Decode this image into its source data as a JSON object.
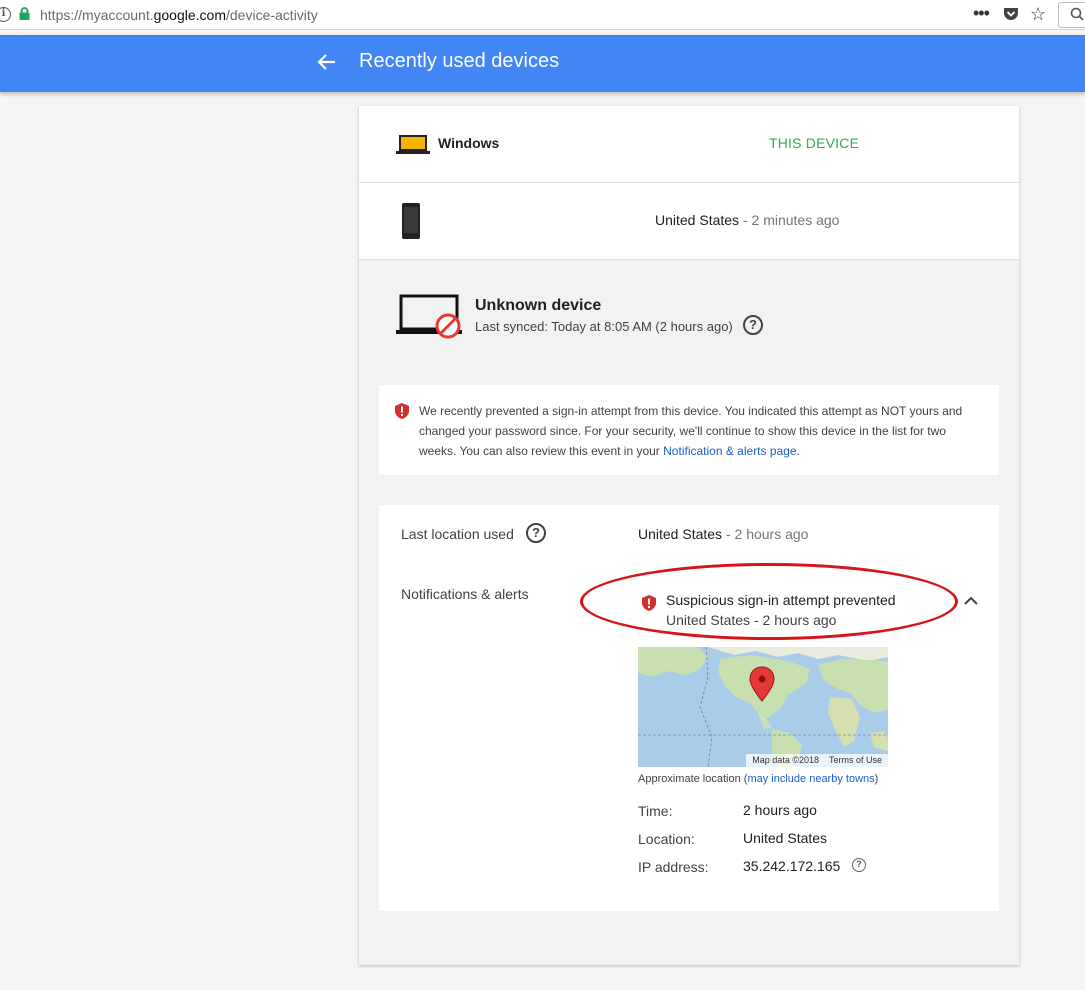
{
  "browser": {
    "url_prefix": "https://myaccount.",
    "url_domain": "google.com",
    "url_path": "/device-activity"
  },
  "header": {
    "title": "Recently used devices"
  },
  "devices": {
    "windows": {
      "name": "Windows",
      "status": "THIS DEVICE"
    },
    "phone": {
      "location": "United States",
      "separator": " - ",
      "time": "2 minutes ago"
    }
  },
  "unknown": {
    "title": "Unknown device",
    "subtitle": "Last synced: Today at 8:05 AM (2 hours ago)",
    "warning_text": "We recently prevented a sign-in attempt from this device. You indicated this attempt as NOT yours and changed your password since. For your security, we'll continue to show this device in the list for two weeks. You can also review this event in your ",
    "warning_link": "Notification & alerts page",
    "warning_end": "."
  },
  "details": {
    "last_location_label": "Last location used",
    "last_location": "United States",
    "separator": " - ",
    "last_time": "2 hours ago",
    "notifications_label": "Notifications & alerts",
    "alert_title": "Suspicious sign-in attempt prevented",
    "alert_location": "United States",
    "alert_time": "2 hours ago",
    "map_data": "Map data ©2018",
    "terms": "Terms of Use",
    "approx_prefix": "Approximate location (",
    "approx_link": "may include nearby towns",
    "approx_suffix": ")",
    "time_label": "Time:",
    "time_value": "2 hours ago",
    "location_label": "Location:",
    "location_value": "United States",
    "ip_label": "IP address:",
    "ip_value": "35.242.172.165"
  },
  "colors": {
    "header_blue": "#4285f4",
    "this_device_green": "#34a853",
    "alert_red": "#d6151b",
    "link_blue": "#1a5fcc"
  },
  "icons": [
    "info-icon",
    "lock-icon",
    "more-icon",
    "pocket-icon",
    "star-icon",
    "back-arrow-icon",
    "laptop-icon",
    "phone-icon",
    "unknown-device-icon",
    "shield-icon",
    "help-icon",
    "chevron-up-icon",
    "map-pin-icon"
  ]
}
